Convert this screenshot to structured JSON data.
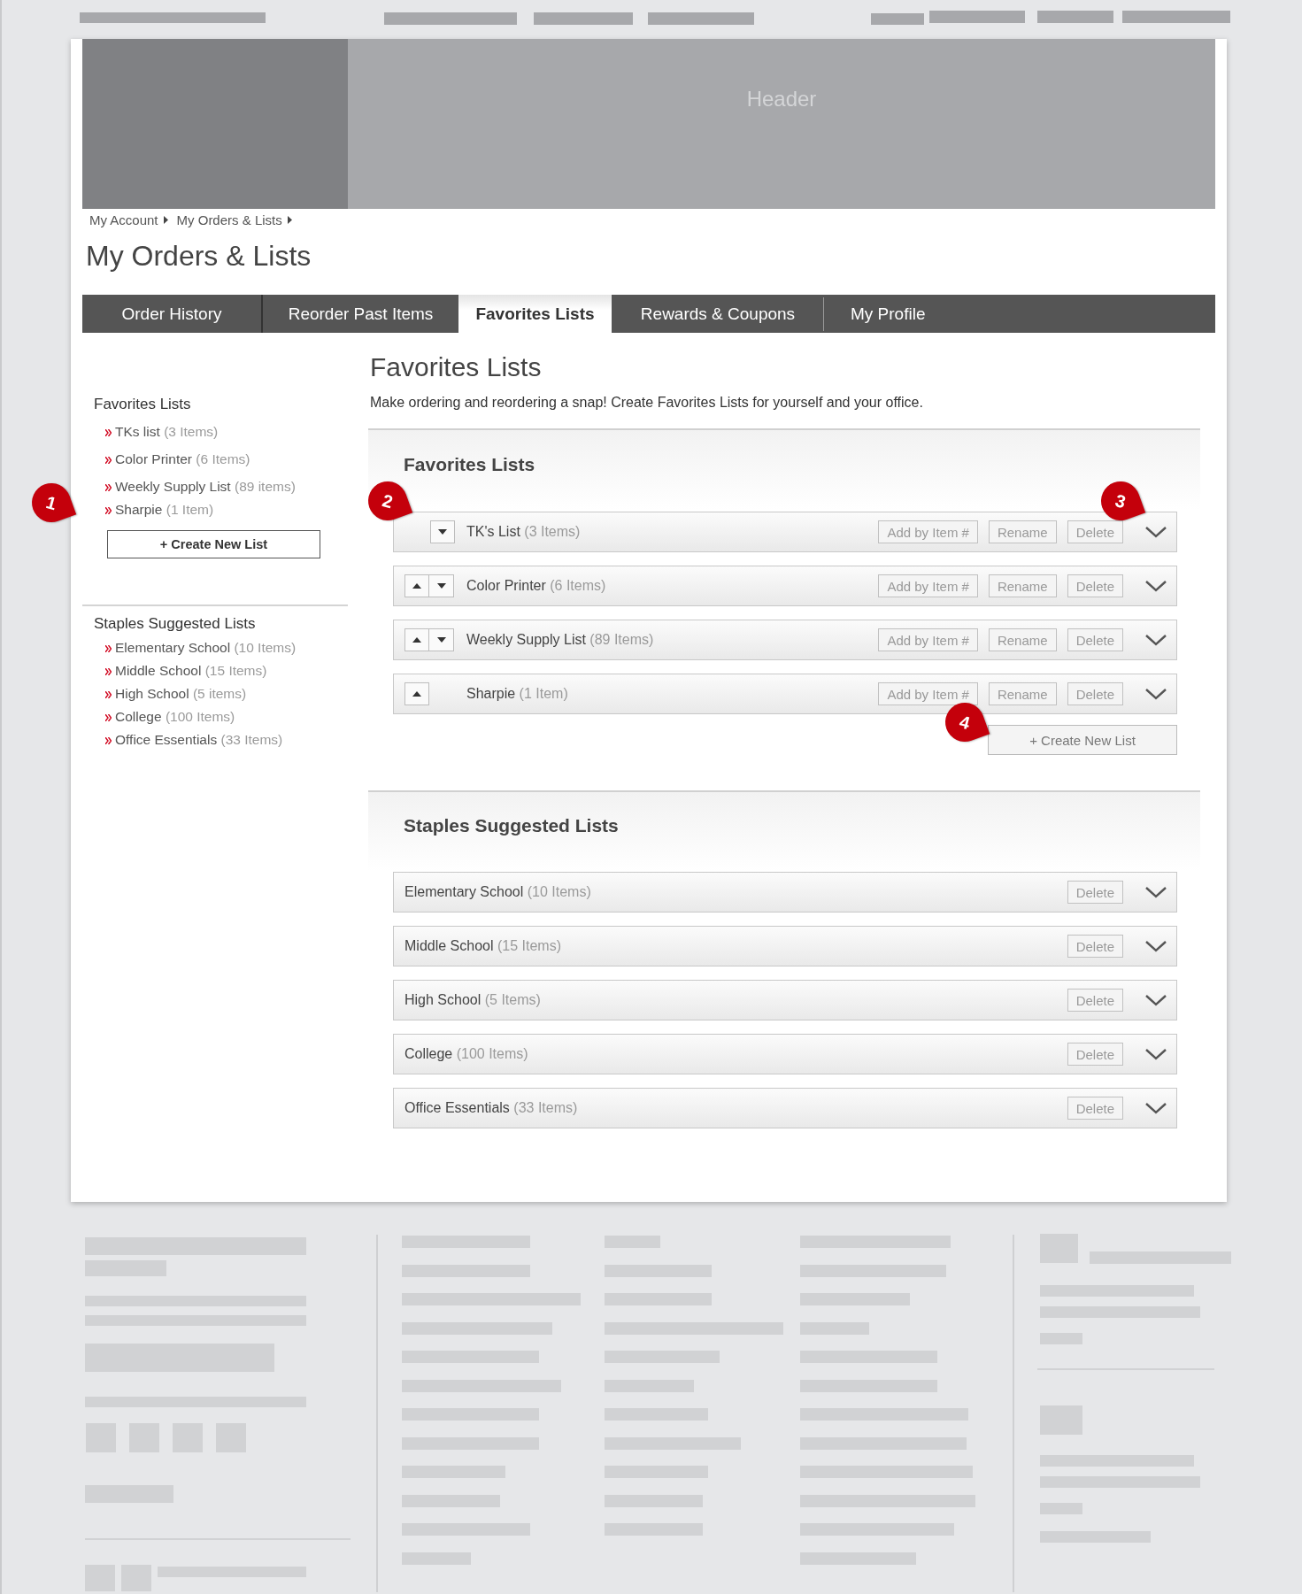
{
  "header": {
    "label": "Header"
  },
  "breadcrumb": [
    "My Account",
    "My Orders & Lists"
  ],
  "title": "My Orders & Lists",
  "tabs": [
    {
      "label": "Order History",
      "selected": false
    },
    {
      "label": "Reorder Past Items",
      "selected": false
    },
    {
      "label": "Favorites Lists",
      "selected": true
    },
    {
      "label": "Rewards & Coupons",
      "selected": false
    },
    {
      "label": "My Profile",
      "selected": false
    }
  ],
  "sidebar": {
    "favorites": {
      "title": "Favorites Lists",
      "items": [
        {
          "name": "TKs list",
          "count": "(3 Items)"
        },
        {
          "name": "Color Printer",
          "count": "(6 Items)"
        },
        {
          "name": "Weekly Supply List",
          "count": "(89 items)"
        },
        {
          "name": "Sharpie",
          "count": "(1 Item)"
        }
      ]
    },
    "create_button": "+ Create New List",
    "suggested": {
      "title": "Staples Suggested Lists",
      "items": [
        {
          "name": "Elementary School",
          "count": "(10 Items)"
        },
        {
          "name": "Middle School",
          "count": "(15 Items)"
        },
        {
          "name": "High School",
          "count": "(5 items)"
        },
        {
          "name": "College",
          "count": "(100 Items)"
        },
        {
          "name": "Office Essentials",
          "count": "(33 Items)"
        }
      ]
    }
  },
  "main": {
    "title": "Favorites Lists",
    "description": "Make ordering and reordering a snap! Create Favorites Lists for yourself and your office.",
    "favorites": {
      "title": "Favorites Lists",
      "lists": [
        {
          "name": "TK's List",
          "count": "(3 Items)",
          "can_move_up": false,
          "can_move_down": true,
          "buttons": [
            "Add by Item #",
            "Rename",
            "Delete"
          ]
        },
        {
          "name": "Color Printer",
          "count": "(6 Items)",
          "can_move_up": true,
          "can_move_down": true,
          "buttons": [
            "Add by Item #",
            "Rename",
            "Delete"
          ]
        },
        {
          "name": "Weekly Supply List",
          "count": "(89 Items)",
          "can_move_up": true,
          "can_move_down": true,
          "buttons": [
            "Add by Item #",
            "Rename",
            "Delete"
          ]
        },
        {
          "name": "Sharpie",
          "count": "(1 Item)",
          "can_move_up": true,
          "can_move_down": false,
          "buttons": [
            "Add by Item #",
            "Rename",
            "Delete"
          ]
        }
      ],
      "create_button": "+ Create New List"
    },
    "suggested": {
      "title": "Staples Suggested Lists",
      "lists": [
        {
          "name": "Elementary School",
          "count": "(10 Items)",
          "buttons": [
            "Delete"
          ]
        },
        {
          "name": "Middle School",
          "count": "(15 Items)",
          "buttons": [
            "Delete"
          ]
        },
        {
          "name": "High School",
          "count": "(5 Items)",
          "buttons": [
            "Delete"
          ]
        },
        {
          "name": "College",
          "count": "(100 Items)",
          "buttons": [
            "Delete"
          ]
        },
        {
          "name": "Office Essentials",
          "count": "(33 Items)",
          "buttons": [
            "Delete"
          ]
        }
      ]
    }
  },
  "annotations": [
    "1",
    "2",
    "3",
    "4"
  ]
}
